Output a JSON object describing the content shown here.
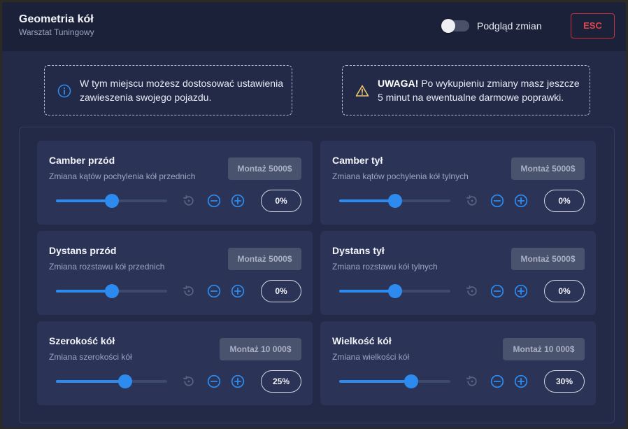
{
  "header": {
    "title": "Geometria kół",
    "subtitle": "Warsztat Tuningowy",
    "preview_label": "Podgląd zmian",
    "preview_enabled": false,
    "esc_label": "ESC"
  },
  "notices": {
    "info": {
      "icon": "info-icon",
      "text": "W tym miejscu możesz dostosować ustawienia zawieszenia swojego pojazdu."
    },
    "warning": {
      "icon": "warning-icon",
      "bold": "UWAGA!",
      "text": " Po wykupieniu zmiany masz jeszcze 5 minut na ewentualne darmowe poprawki."
    }
  },
  "colors": {
    "accent": "#2d8bf0",
    "danger": "#e0454d",
    "warning": "#e9c46a"
  },
  "cards": [
    {
      "title": "Camber przód",
      "desc": "Zmiana kątów pochylenia kół przednich",
      "price": "Montaż 5000$",
      "value": "0%",
      "slider": 0.5
    },
    {
      "title": "Camber tył",
      "desc": "Zmiana kątów pochylenia kół tylnych",
      "price": "Montaż 5000$",
      "value": "0%",
      "slider": 0.5
    },
    {
      "title": "Dystans przód",
      "desc": "Zmiana rozstawu kół przednich",
      "price": "Montaż 5000$",
      "value": "0%",
      "slider": 0.5
    },
    {
      "title": "Dystans tył",
      "desc": "Zmiana rozstawu kół tylnych",
      "price": "Montaż 5000$",
      "value": "0%",
      "slider": 0.5
    },
    {
      "title": "Szerokość kół",
      "desc": "Zmiana szerokości kół",
      "price": "Montaż 10 000$",
      "value": "25%",
      "slider": 0.625
    },
    {
      "title": "Wielkość kół",
      "desc": "Zmiana wielkości kół",
      "price": "Montaż 10 000$",
      "value": "30%",
      "slider": 0.65
    }
  ]
}
